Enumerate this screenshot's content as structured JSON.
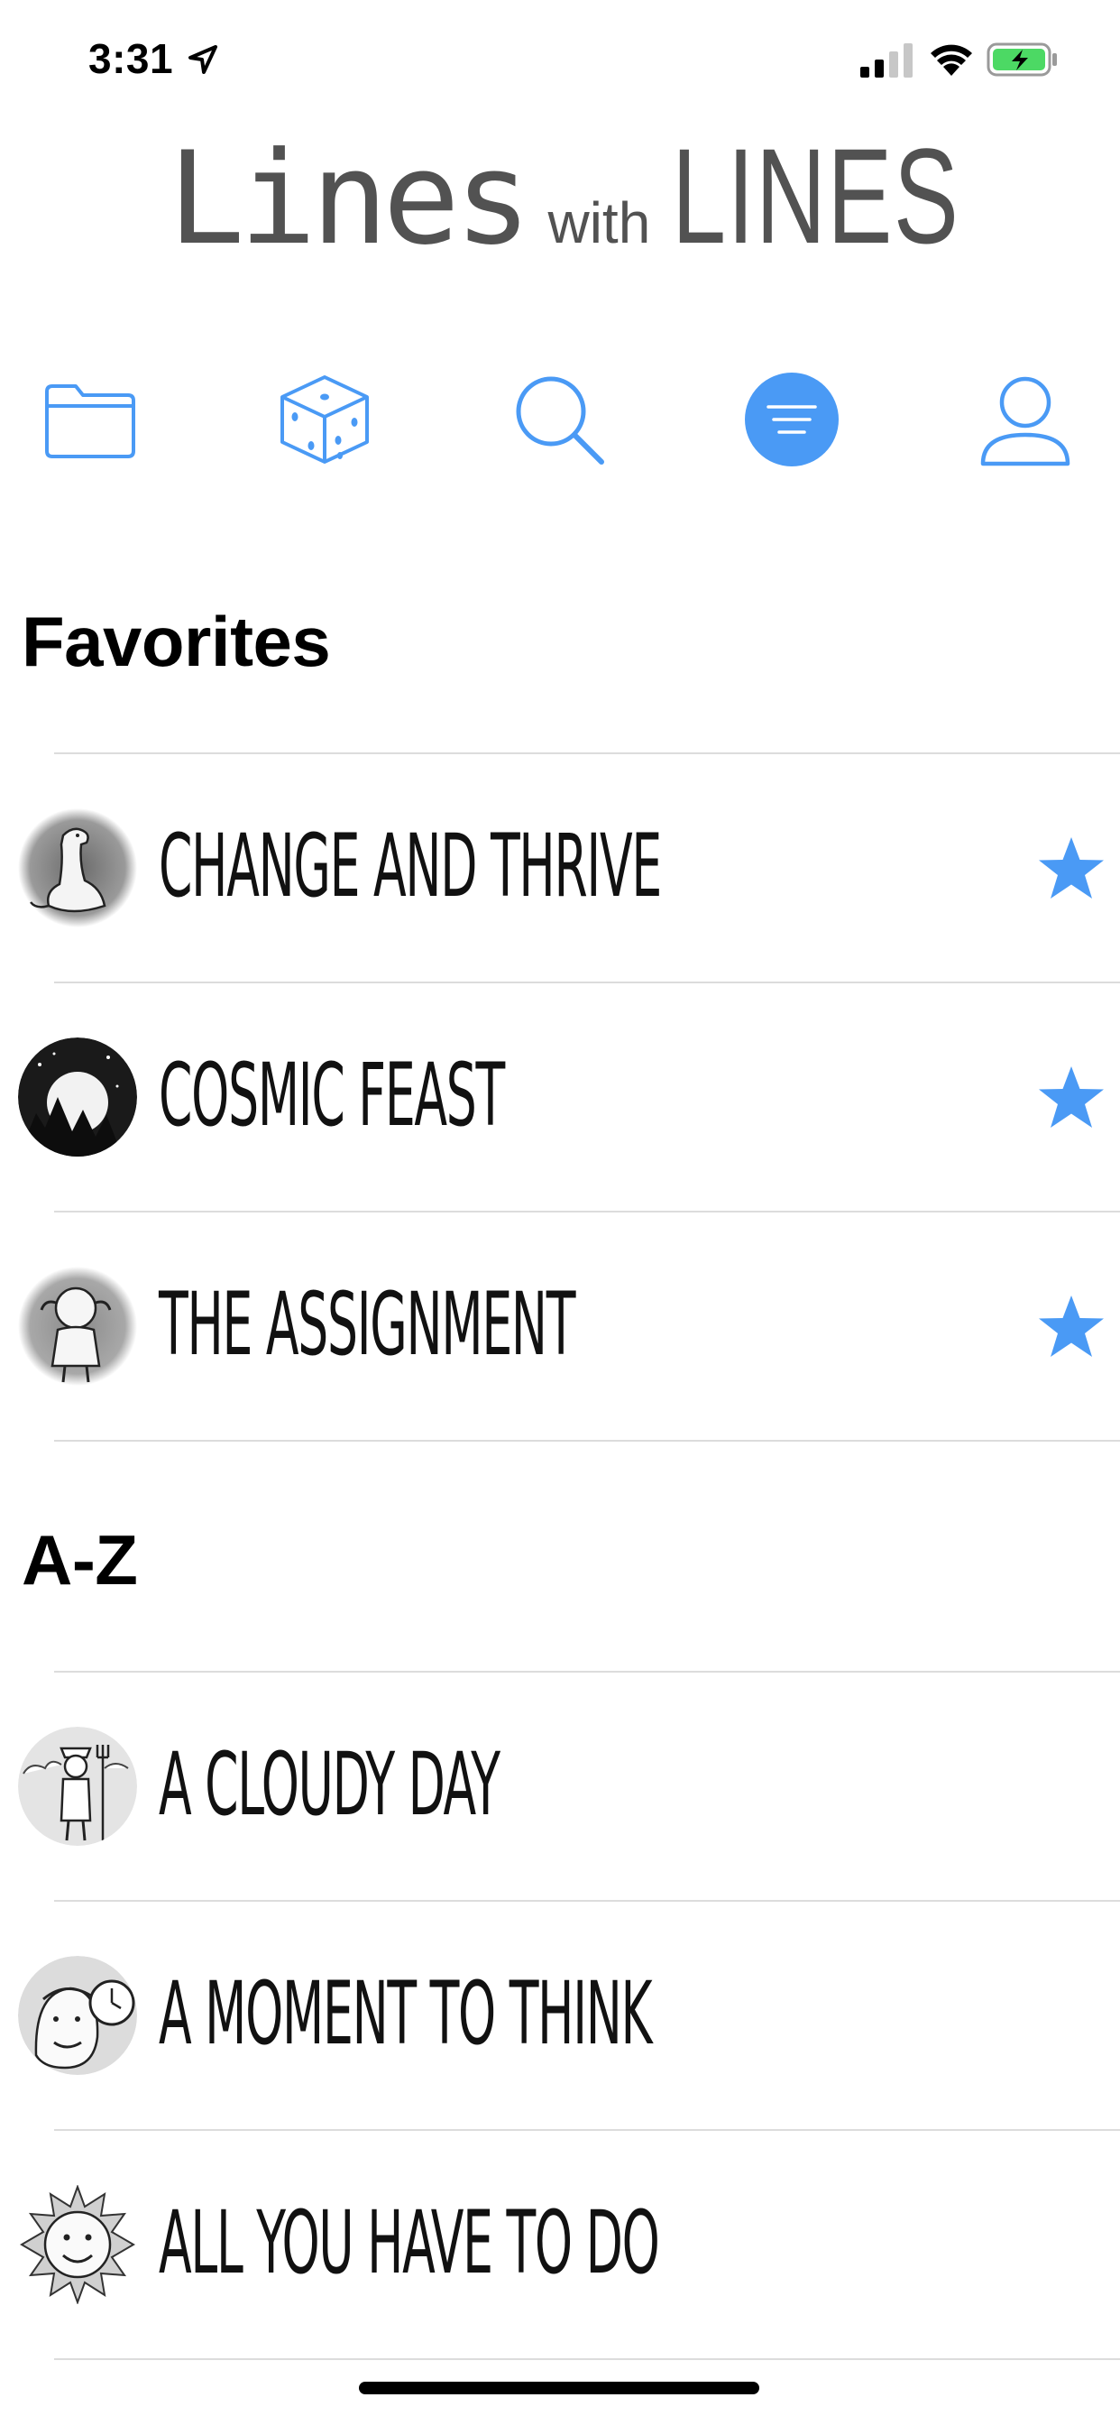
{
  "status_bar": {
    "time": "3:31",
    "location_icon": "location-arrow-icon",
    "signal_icon": "cellular-signal-icon",
    "wifi_icon": "wifi-icon",
    "battery_icon": "battery-charging-icon",
    "battery_color": "#4cd964"
  },
  "logo": {
    "part1": "Lines",
    "part2": "with",
    "part3": "LINES"
  },
  "toolbar": {
    "accent": "#4a9af5",
    "items": [
      {
        "icon": "folder-icon",
        "active": false
      },
      {
        "icon": "dice-icon",
        "active": false
      },
      {
        "icon": "search-icon",
        "active": false
      },
      {
        "icon": "sort-filter-icon",
        "active": true
      },
      {
        "icon": "profile-icon",
        "active": false
      }
    ]
  },
  "sections": {
    "favorites": {
      "title": "Favorites",
      "items": [
        {
          "title": "Change And Thrive",
          "avatar": "dinosaur-sketch",
          "favorite": true
        },
        {
          "title": "Cosmic Feast",
          "avatar": "night-forest-moon-sketch",
          "favorite": true
        },
        {
          "title": "The Assignment",
          "avatar": "girl-pigtails-sketch",
          "favorite": true
        }
      ]
    },
    "az": {
      "title": "A-Z",
      "items": [
        {
          "title": "A Cloudy Day",
          "avatar": "farmer-pitchfork-sketch",
          "favorite": false
        },
        {
          "title": "A Moment To Think",
          "avatar": "man-clock-sketch",
          "favorite": false
        },
        {
          "title": "All You Have To Do",
          "avatar": "sun-face-sketch",
          "favorite": false
        }
      ]
    }
  }
}
